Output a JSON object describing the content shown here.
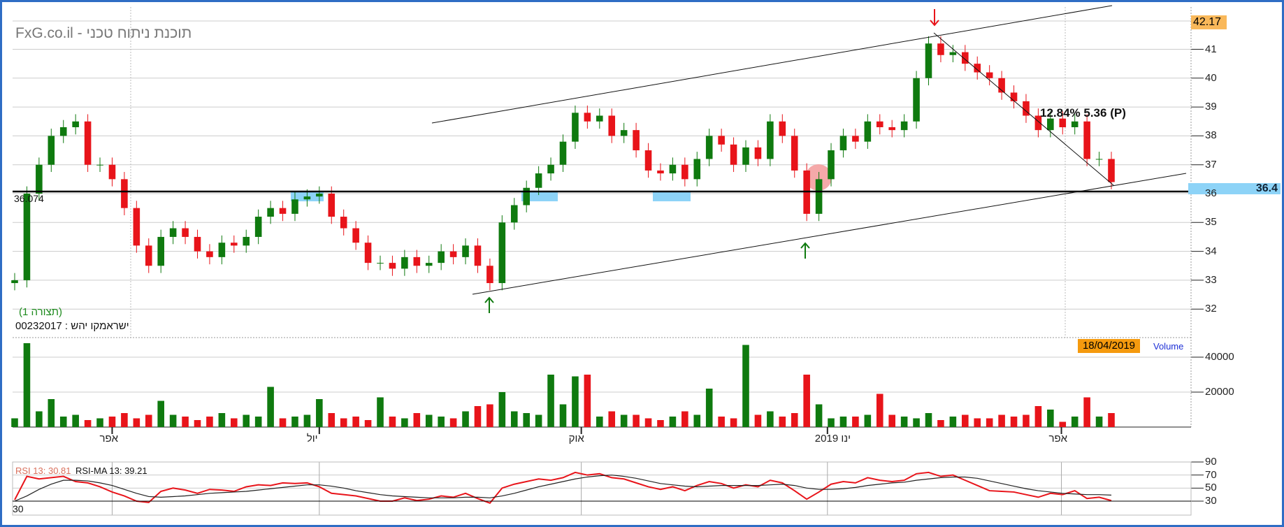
{
  "header": {
    "title": "FxG.co.il - תוכנת ניתוח טכני"
  },
  "labels": {
    "last_price": "42.17",
    "current_level": "36.4",
    "support_level": "36.074",
    "annotation": "12.84% 5.36 (P)",
    "pattern": "(תצורה 1)",
    "identifier": "00232017 : ישראמקו יהש",
    "date": "18/04/2019",
    "volume_label": "Volume",
    "rsi_label": "RSI 13:  30.81",
    "rsi_ma_label": "RSI-MA 13:  39.21",
    "rsi_level_label": "30"
  },
  "colors": {
    "up": "#0f7a0f",
    "down": "#e8141a",
    "rsi": "#e8141a",
    "rsi_ma": "#222222",
    "highlight": "#8dd3f7",
    "circle": "#f4a0a0"
  },
  "chart_data": [
    {
      "type": "candlestick",
      "title": "Price",
      "ylim": [
        31.5,
        42.5
      ],
      "yticks": [
        "33",
        "34",
        "35",
        "36",
        "37",
        "38",
        "39",
        "40",
        "41",
        "32"
      ],
      "xticks": [
        {
          "label": "אפר",
          "index": 8
        },
        {
          "label": "יול",
          "index": 25
        },
        {
          "label": "אוק",
          "index": 46.5
        },
        {
          "label": "ינו 2019",
          "index": 66.7
        },
        {
          "label": "אפר",
          "index": 85.9
        }
      ],
      "close": [
        33.0,
        36.0,
        37.0,
        38.0,
        38.3,
        38.5,
        37.0,
        37.0,
        36.5,
        35.5,
        34.2,
        33.5,
        34.5,
        34.8,
        34.5,
        34.0,
        33.8,
        34.3,
        34.2,
        34.5,
        35.2,
        35.5,
        35.3,
        35.8,
        35.9,
        36.0,
        35.2,
        34.8,
        34.3,
        33.6,
        33.6,
        33.4,
        33.8,
        33.5,
        33.6,
        34.0,
        33.8,
        34.2,
        33.5,
        32.9,
        35.0,
        35.6,
        36.2,
        36.7,
        37.0,
        37.8,
        38.8,
        38.5,
        38.7,
        38.0,
        38.2,
        37.5,
        36.8,
        36.7,
        37.0,
        36.5,
        37.2,
        38.0,
        37.7,
        37.0,
        37.6,
        37.2,
        38.5,
        38.0,
        36.8,
        35.3,
        36.5,
        37.5,
        38.0,
        37.8,
        38.5,
        38.3,
        38.2,
        38.5,
        40.0,
        41.2,
        40.8,
        40.9,
        40.5,
        40.2,
        40.0,
        39.5,
        39.2,
        38.7,
        38.2,
        38.6,
        38.3,
        38.5,
        37.2,
        37.2,
        36.4
      ],
      "support": 36.074
    },
    {
      "type": "bar",
      "title": "Volume",
      "ylim": [
        0,
        45000
      ],
      "yticks": [
        "40000",
        "20000"
      ],
      "values": [
        5000,
        48000,
        9000,
        16000,
        6000,
        7000,
        4000,
        5000,
        6000,
        8000,
        5000,
        7000,
        15000,
        7000,
        6000,
        4000,
        6000,
        8000,
        5000,
        7000,
        6000,
        23000,
        5000,
        6000,
        7000,
        16000,
        8000,
        5000,
        6000,
        4000,
        17000,
        6000,
        5000,
        8000,
        7000,
        6000,
        5000,
        9000,
        12000,
        13000,
        20000,
        9000,
        8000,
        7000,
        30000,
        13000,
        29000,
        30000,
        6000,
        9000,
        7000,
        7000,
        5000,
        4000,
        6000,
        9000,
        7000,
        22000,
        6000,
        5000,
        47000,
        7000,
        9000,
        6000,
        8000,
        30000,
        13000,
        5000,
        6000,
        6000,
        7000,
        19000,
        7000,
        6000,
        5000,
        8000,
        4000,
        6000,
        7000,
        5000,
        5000,
        7000,
        6000,
        7000,
        12000,
        10000,
        3000,
        6000,
        17000,
        6000,
        8000
      ],
      "xticks": [
        "אפר",
        "יול",
        "אוק",
        "ינו 2019",
        "אפר"
      ]
    },
    {
      "type": "line",
      "title": "RSI 13",
      "ylim": [
        20,
        90
      ],
      "yticks": [
        "90",
        "70",
        "50",
        "30"
      ],
      "series": [
        {
          "name": "RSI 13",
          "values": [
            32,
            68,
            64,
            66,
            68,
            60,
            58,
            52,
            44,
            38,
            30,
            28,
            45,
            50,
            47,
            42,
            48,
            47,
            45,
            52,
            55,
            54,
            58,
            57,
            58,
            52,
            42,
            40,
            38,
            34,
            30,
            30,
            35,
            31,
            33,
            38,
            36,
            42,
            34,
            27,
            50,
            56,
            60,
            64,
            62,
            66,
            74,
            70,
            72,
            66,
            64,
            58,
            52,
            48,
            52,
            46,
            54,
            60,
            57,
            50,
            55,
            52,
            62,
            58,
            46,
            33,
            44,
            56,
            60,
            58,
            66,
            62,
            60,
            62,
            72,
            74,
            68,
            70,
            62,
            54,
            46,
            45,
            44,
            40,
            36,
            42,
            40,
            46,
            34,
            36,
            30.81
          ]
        },
        {
          "name": "RSI-MA 13",
          "values": [
            30,
            38,
            48,
            56,
            62,
            62,
            61,
            58,
            54,
            48,
            42,
            37,
            36,
            37,
            38,
            40,
            42,
            43,
            44,
            45,
            47,
            49,
            51,
            53,
            55,
            55,
            53,
            50,
            46,
            43,
            40,
            38,
            37,
            36,
            35,
            35,
            35,
            36,
            36,
            35,
            38,
            42,
            47,
            52,
            56,
            60,
            64,
            67,
            69,
            70,
            68,
            65,
            61,
            57,
            55,
            53,
            52,
            53,
            54,
            54,
            54,
            54,
            55,
            56,
            54,
            50,
            48,
            48,
            49,
            51,
            54,
            56,
            58,
            59,
            62,
            64,
            66,
            67,
            67,
            65,
            61,
            57,
            53,
            49,
            46,
            44,
            42,
            41,
            40,
            40,
            39.21
          ]
        }
      ],
      "reference_line": 30
    }
  ]
}
